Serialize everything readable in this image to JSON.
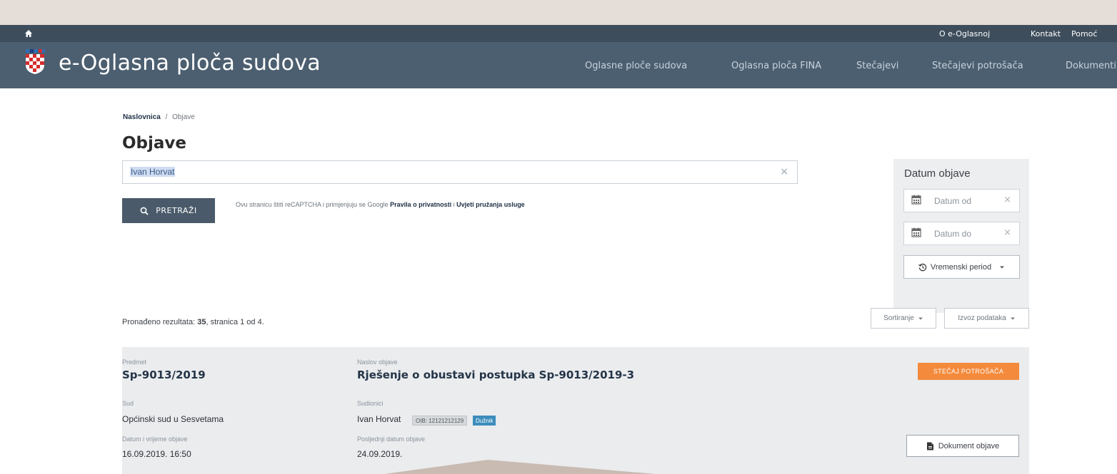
{
  "top_links": [
    "O e-Oglasnoj",
    "Kontakt",
    "Pomoć"
  ],
  "brand": "e-Oglasna ploča sudova",
  "nav": [
    "Oglasne ploče sudova",
    "Oglasna ploča FINA",
    "Stečajevi",
    "Stečajevi potrošača",
    "Dokumenti"
  ],
  "breadcrumb": {
    "home": "Naslovnica",
    "separator": "/",
    "current": "Objave"
  },
  "page_title": "Objave",
  "search": {
    "value": "Ivan Horvat",
    "clear": "×",
    "button_label": "PRETRAŽI"
  },
  "recaptcha": {
    "text": "Ovu stranicu štiti reCAPTCHA i primjenjuju se Google",
    "privacy_link": "Pravila o privatnosti",
    "conjunction": "i",
    "terms_link": "Uvjeti pružanja usluge"
  },
  "date_filter": {
    "title": "Datum objave",
    "from_placeholder": "Datum od",
    "to_placeholder": "Datum do",
    "clear": "×",
    "period_label": "Vremenski period"
  },
  "results": {
    "prefix": "Pronađeno rezultata:",
    "count": "35",
    "suffix": ", stranica 1 od 4."
  },
  "toolbar": {
    "sort_label": "Sortiranje",
    "export_label": "Izvoz podataka"
  },
  "card": {
    "subject_label": "Predmet",
    "subject": "Sp-9013/2019",
    "title_label": "Naslov objave",
    "title": "Rješenje o obustavi postupka Sp-9013/2019-3",
    "status_badge": "STEČAJ POTROŠAČA",
    "court_label": "Sud",
    "court": "Općinski sud u Sesvetama",
    "participants_label": "Sudionici",
    "participant_name": "Ivan Horvat",
    "participant_oib": "OIB: 12121212129",
    "participant_role": "Dužnik",
    "published_label": "Datum i vrijeme objave",
    "published": "16.09.2019. 16:50",
    "last_date_label": "Posljednji datum objave",
    "last_date": "24.09.2019.",
    "document_button": "Dokument objave"
  },
  "colors": {
    "top_bar": "#3d4d5c",
    "nav_bar": "#4c5f70",
    "button_dark": "#4a5a6a",
    "badge_orange": "#f48a3c",
    "badge_blue": "#3c8dbc",
    "backdrop": "#e5ddd7"
  }
}
